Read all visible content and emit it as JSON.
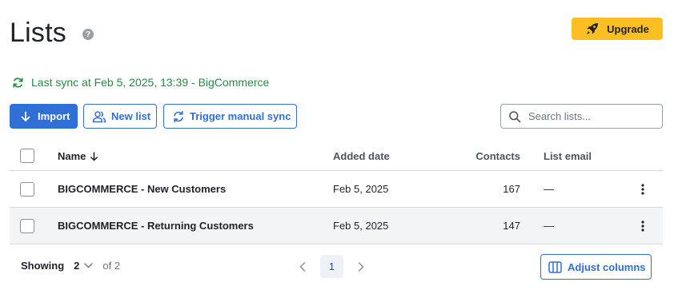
{
  "page": {
    "title": "Lists"
  },
  "header": {
    "upgrade_label": "Upgrade"
  },
  "sync": {
    "status_text": "Last sync at Feb 5, 2025, 13:39 - BigCommerce"
  },
  "toolbar": {
    "import_label": "Import",
    "new_list_label": "New list",
    "trigger_sync_label": "Trigger manual sync",
    "search_placeholder": "Search lists..."
  },
  "table": {
    "columns": {
      "name": "Name",
      "added_date": "Added date",
      "contacts": "Contacts",
      "list_email": "List email"
    },
    "rows": [
      {
        "name": "BIGCOMMERCE - New Customers",
        "added_date": "Feb 5, 2025",
        "contacts": "167",
        "list_email": "—"
      },
      {
        "name": "BIGCOMMERCE - Returning Customers",
        "added_date": "Feb 5, 2025",
        "contacts": "147",
        "list_email": "—"
      }
    ]
  },
  "footer": {
    "showing_label": "Showing",
    "per_page_value": "2",
    "of_total": "of 2",
    "current_page": "1",
    "adjust_columns_label": "Adjust columns"
  },
  "colors": {
    "accent": "#2f6fd6",
    "upgrade": "#fbbf24",
    "sync_green": "#1e8e3e",
    "row_alt": "#f3f4f6"
  }
}
